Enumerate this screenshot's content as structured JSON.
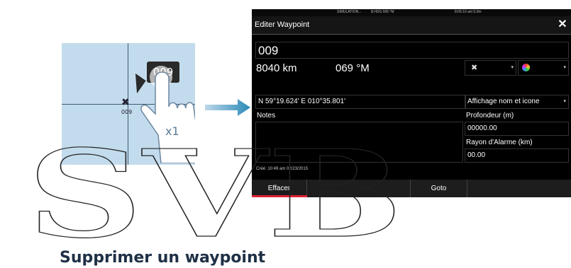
{
  "map": {
    "waypoint_label": "009",
    "bubble_text": "009",
    "tap_count": "x1"
  },
  "dialog": {
    "status_simulation": "SIMULATION...",
    "status_heading": "$ HDG 006 °M",
    "status_time": "8:05:10 am  5.0m",
    "title": "Editer Waypoint",
    "name": "009",
    "distance": "8040 km",
    "bearing": "069 °M",
    "position": "N 59°19.624'  E 010°35.801'",
    "display_mode": "Affichage nom et icone",
    "notes_label": "Notes",
    "depth_label": "Profondeur (m)",
    "depth_value": "00000.00",
    "alarm_label": "Rayon d'Alarme (km)",
    "alarm_value": "00.00",
    "created": "Créé: 10:49 am  02/23/2015",
    "buttons": [
      "Effacer",
      "Goto"
    ]
  },
  "watermark": "SVB",
  "heading": "Supprimer un waypoint"
}
